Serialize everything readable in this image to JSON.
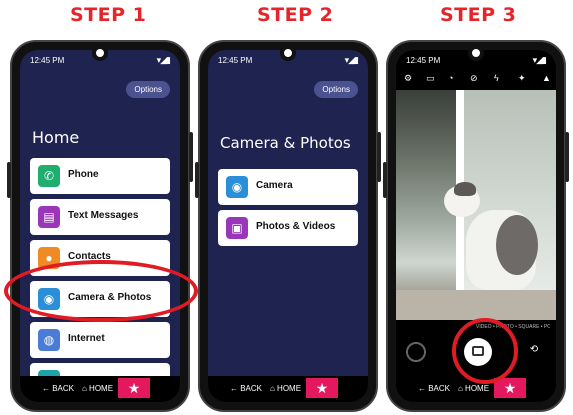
{
  "steps": [
    "STEP 1",
    "STEP 2",
    "STEP 3"
  ],
  "accent_color": "#e5252a",
  "status_time": "12:45 PM",
  "options_label": "Options",
  "nav": {
    "back": "← BACK",
    "home": "⌂ HOME",
    "star": "★"
  },
  "screen1": {
    "title": "Home",
    "items": [
      {
        "label": "Phone",
        "icon": "phone-icon",
        "color": "#1fae6f"
      },
      {
        "label": "Text Messages",
        "icon": "message-icon",
        "color": "#9a36b8"
      },
      {
        "label": "Contacts",
        "icon": "contact-icon",
        "color": "#f08a24"
      },
      {
        "label": "Camera & Photos",
        "icon": "camera-icon",
        "color": "#2a8fd8"
      },
      {
        "label": "Internet",
        "icon": "globe-icon",
        "color": "#4a7bd6"
      }
    ]
  },
  "screen2": {
    "title": "Camera & Photos",
    "items": [
      {
        "label": "Camera",
        "icon": "camera-icon",
        "color": "#2a8fd8"
      },
      {
        "label": "Photos & Videos",
        "icon": "gallery-icon",
        "color": "#9a36b8"
      }
    ]
  },
  "screen3": {
    "modes": "VIDEO • PHOTO • SQUARE • PORTRAIT • PRO"
  }
}
